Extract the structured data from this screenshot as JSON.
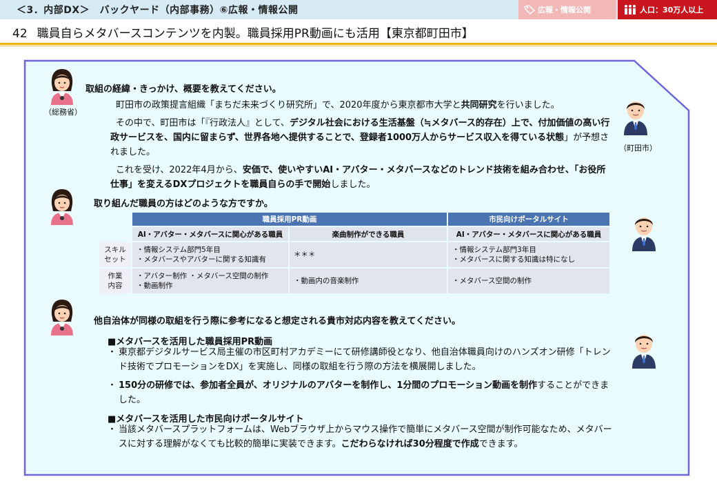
{
  "header": {
    "section": "＜3．内部DX＞　バックヤード（内部事務）⑥広報・情報公開",
    "tag_pr": "広報・情報公開",
    "tag_population": "人口：30万人以上",
    "title_number": "42",
    "title": "職員自らメタバースコンテンツを内製。職員採用PR動画にも活用【東京都町田市】"
  },
  "captions": {
    "soumusho": "（総務省）",
    "machida": "（町田市）"
  },
  "q1": {
    "question": "取組の経緯・きっかけ、概要を教えてください。",
    "p1_a": "町田市の政策提言組織「まちだ未来づくり研究所」で、2020年度から東京都市大学と",
    "p1_b": "共同研究",
    "p1_c": "を行いました。",
    "p2_a": "その中で、町田市は「『行政法人』として、",
    "p2_b": "デジタル社会における生活基盤（≒メタバース的存在）上で、付加価値の高い行政サービスを、国内に留まらず、世界各地へ提供することで、登録者1000万人からサービス収入を得ている状態",
    "p2_c": "」が予想されました。",
    "p3_a": "これを受け、2022年4月から、",
    "p3_b": "安価で、使いやすいAI・アバター・メタバースなどのトレンド技術を組み合わせ、「お役所仕事」を変えるDXプロジェクトを職員自らの手で開始",
    "p3_c": "しました。"
  },
  "q2": {
    "question": "取り組んだ職員の方はどのような方ですか。",
    "table": {
      "group1": "職員採用PR動画",
      "group2": "市民向けポータルサイト",
      "col1": "AI・アバター・メタバースに関心がある職員",
      "col2": "楽曲制作ができる職員",
      "col3": "AI・アバター・メタバースに関心がある職員",
      "row1_label_a": "スキル",
      "row1_label_b": "セット",
      "row1_c1_a": "・情報システム部門5年目",
      "row1_c1_b": "・メタバースやアバターに関する知識有",
      "row1_c2": "＊＊＊",
      "row1_c3_a": "・情報システム部門3年目",
      "row1_c3_b": "・メタバースに関する知識は特になし",
      "row2_label_a": "作業",
      "row2_label_b": "内容",
      "row2_c1_a": "・アバター制作 ・メタバース空間の制作",
      "row2_c1_b": "・動画制作",
      "row2_c2": "・動画内の音楽制作",
      "row2_c3": "・メタバース空間の制作"
    }
  },
  "q3": {
    "question": "他自治体が同様の取組を行う際に参考になると想定される貴市対応内容を教えてください。",
    "h1": "■メタバースを活用した職員採用PR動画",
    "b1": "東京都デジタルサービス局主催の市区町村アカデミーにて研修講師役となり、他自治体職員向けのハンズオン研修「トレンド技術でプロモーションをDX」を実施し、同様の取組を行う際の方法を横展開しました。",
    "b2_a": "150分の研修では、参加者全員が、オリジナルのアバターを制作し、1分間のプロモーション動画を制作",
    "b2_b": "することができました。",
    "h2": "■メタバースを活用した市民向けポータルサイト",
    "b3_a": "当該メタバースプラットフォームは、Webブラウザ上からマウス操作で簡単にメタバース空間が制作可能なため、メタバースに対する理解がなくても比較的簡単に実装できます。",
    "b3_b": "こだわらなければ30分程度で作成",
    "b3_c": "できます。"
  },
  "colors": {
    "topbar": "#d6eaf3",
    "panel_fill": "#e9fbfd",
    "panel_border": "#6d66d8",
    "accent_gold": "#f0b400",
    "table_header": "#4a74b2",
    "tag_red": "#c9151e",
    "tag_pink": "#f2b8b8"
  }
}
